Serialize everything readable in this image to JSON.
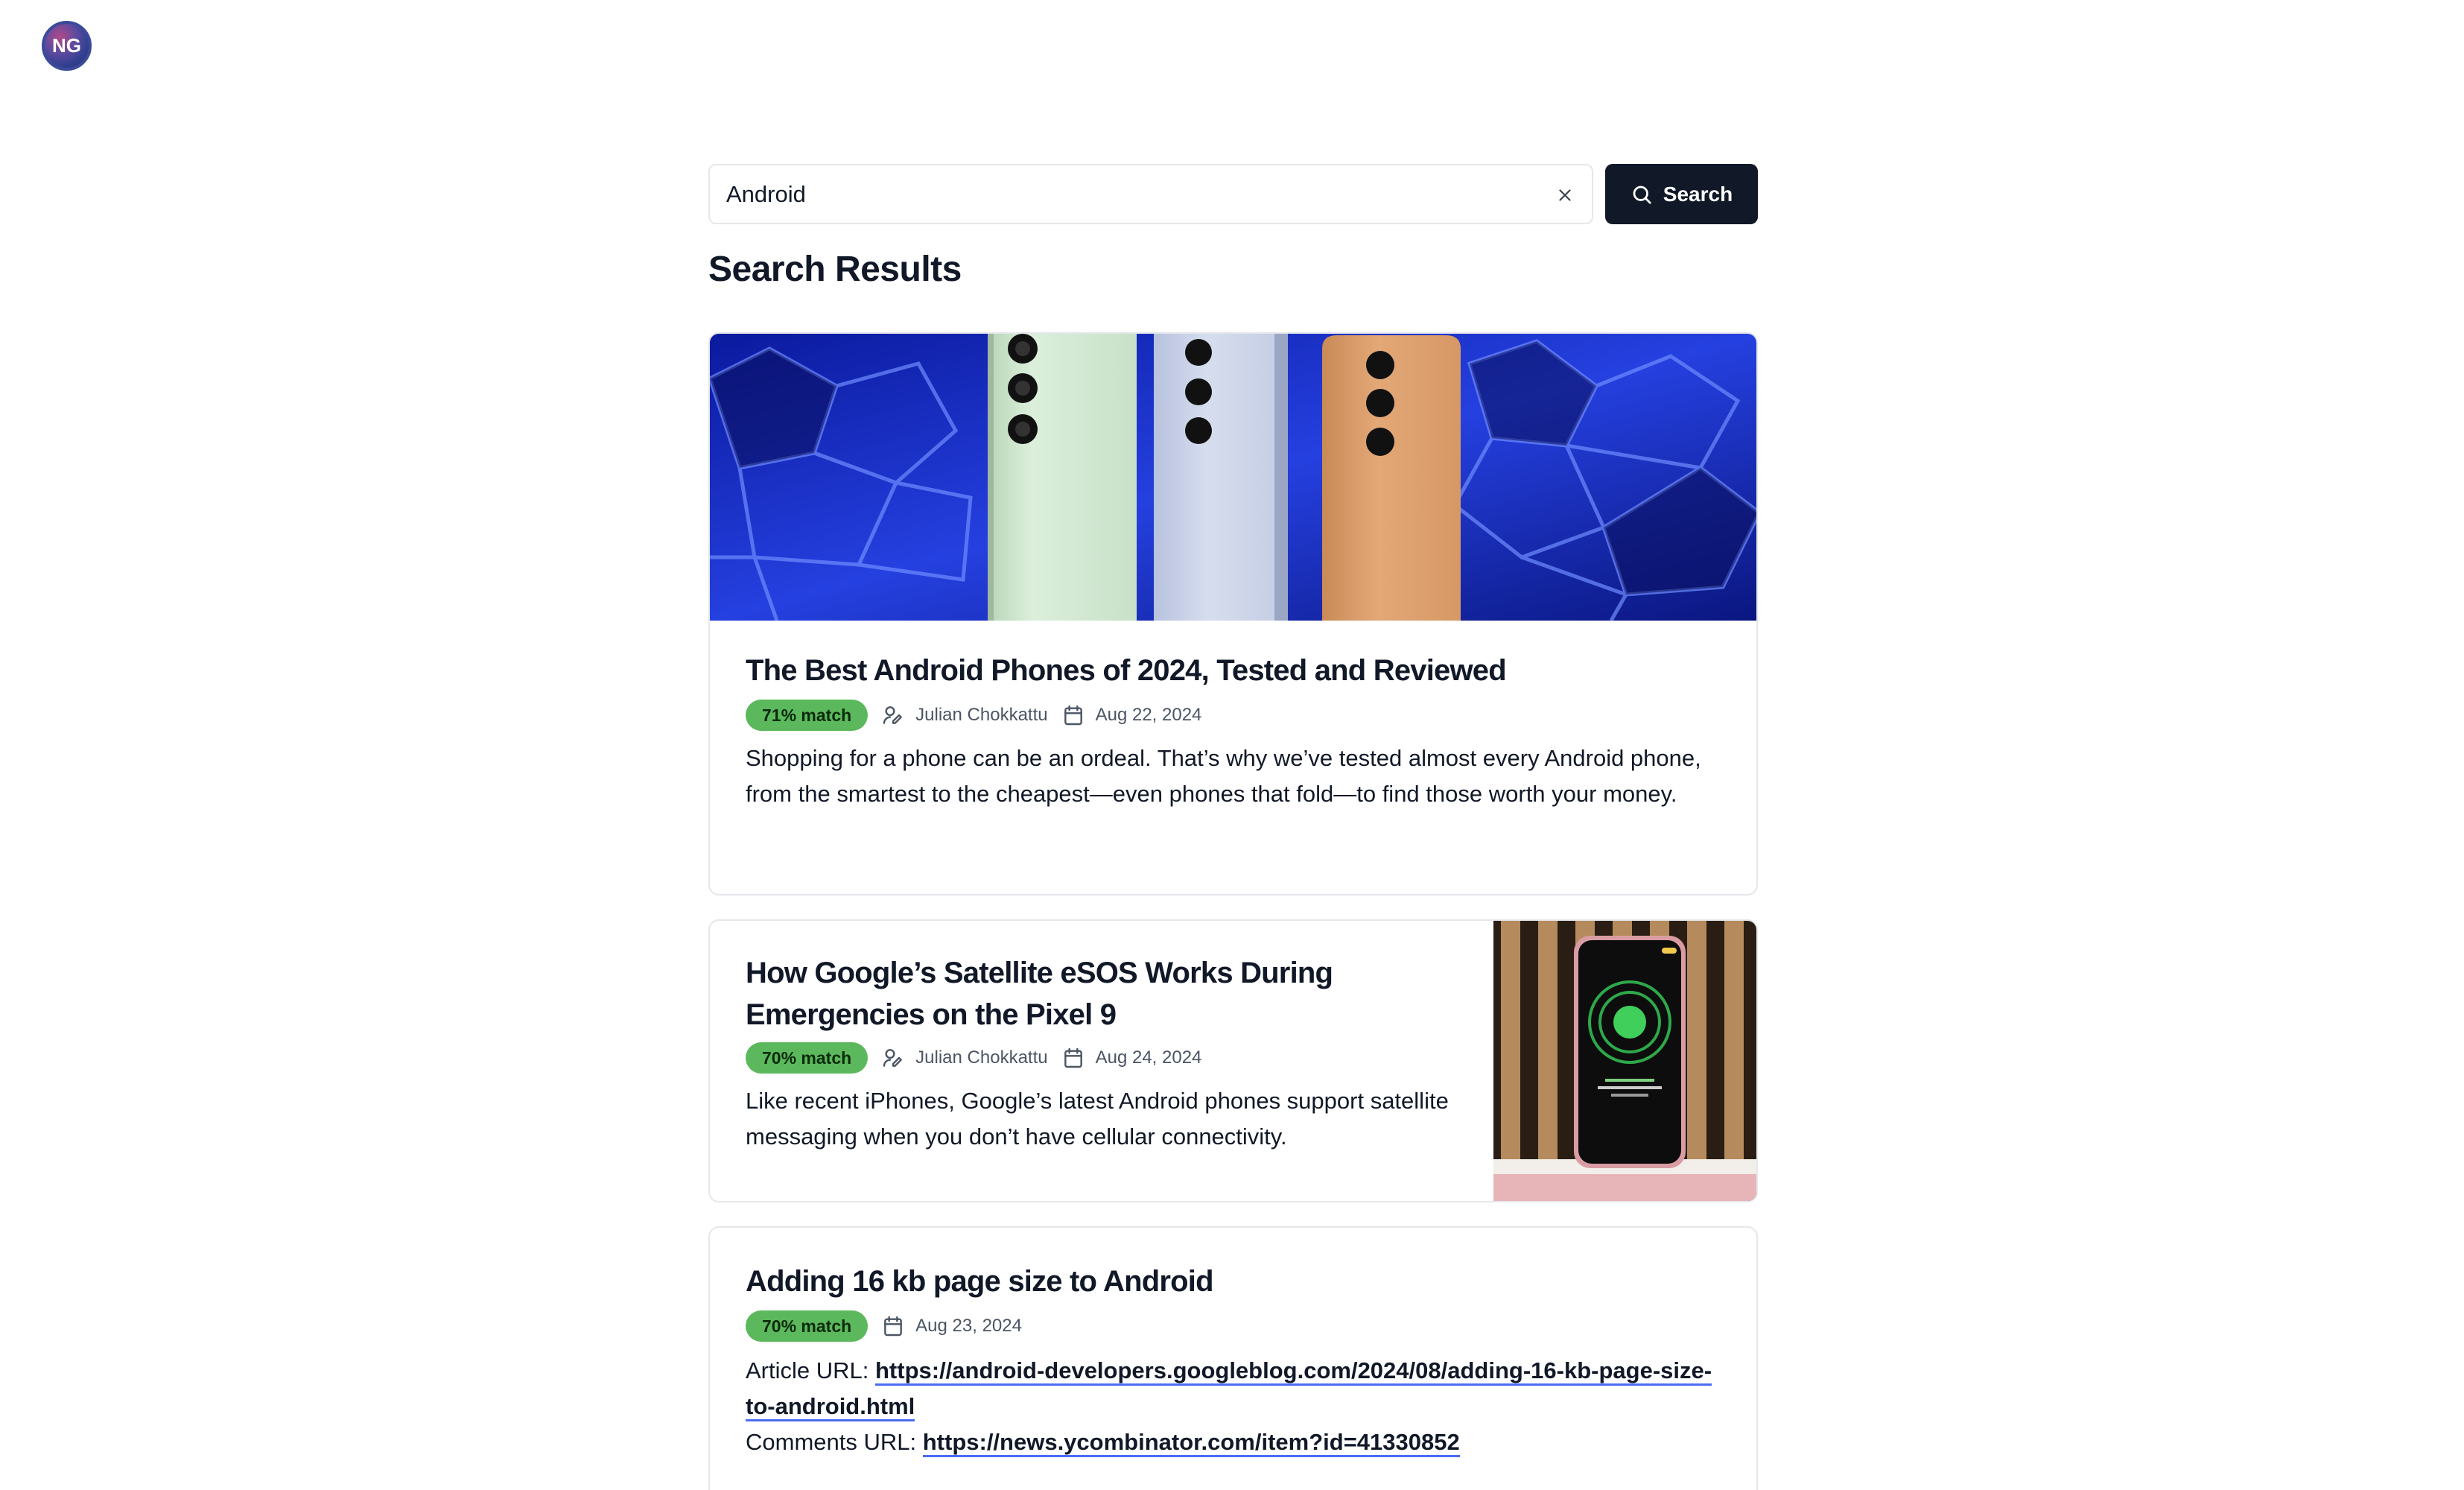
{
  "user": {
    "initials": "NG"
  },
  "search": {
    "query": "Android",
    "button_label": "Search"
  },
  "results_heading": "Search Results",
  "results": [
    {
      "title": "The Best Android Phones of 2024, Tested and Reviewed",
      "match": "71% match",
      "author": "Julian Chokkattu",
      "date": "Aug 22, 2024",
      "description": "Shopping for a phone can be an ordeal. That’s why we’ve tested almost every Android phone, from the smartest to the cheapest—even phones that fold—to find those worth your money.",
      "image": "phones-hero-image"
    },
    {
      "title": "How Google’s Satellite eSOS Works During Emergencies on the Pixel 9",
      "match": "70% match",
      "author": "Julian Chokkattu",
      "date": "Aug 24, 2024",
      "description": "Like recent iPhones, Google’s latest Android phones support satellite messaging when you don’t have cellular connectivity.",
      "image": "pixel-phone-thumbnail"
    },
    {
      "title": "Adding 16 kb page size to Android",
      "match": "70% match",
      "date": "Aug 23, 2024",
      "article_label": "Article URL:",
      "article_url": "https://android-developers.googleblog.com/2024/08/adding-16-kb-page-size-to-android.html",
      "comments_label": "Comments URL:",
      "comments_url": "https://news.ycombinator.com/item?id=41330852"
    }
  ],
  "colors": {
    "primary": "#111827",
    "match_badge": "#5cb85c",
    "link_underline": "#4a6cf7",
    "border": "#e5e7eb"
  }
}
